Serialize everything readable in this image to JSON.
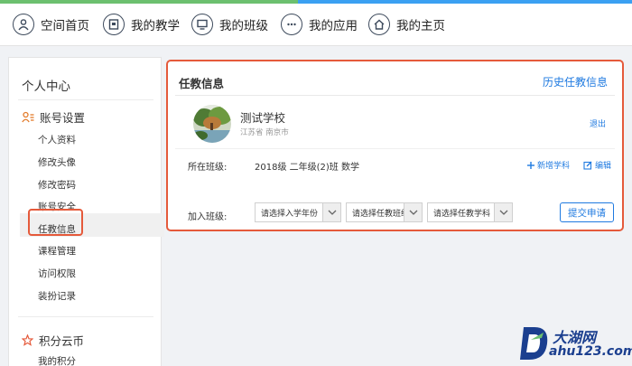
{
  "nav": {
    "items": [
      {
        "label": "空间首页",
        "icon": "user-icon"
      },
      {
        "label": "我的教学",
        "icon": "lesson-icon"
      },
      {
        "label": "我的班级",
        "icon": "monitor-icon"
      },
      {
        "label": "我的应用",
        "icon": "more-icon"
      },
      {
        "label": "我的主页",
        "icon": "home-icon"
      }
    ]
  },
  "sidebar": {
    "title": "个人中心",
    "account_section": "账号设置",
    "items": [
      "个人资料",
      "修改头像",
      "修改密码",
      "账号安全",
      "任教信息",
      "课程管理",
      "访问权限",
      "装扮记录"
    ],
    "active_item": "任教信息",
    "points_section": "积分云币",
    "points_items": [
      "我的积分"
    ]
  },
  "main": {
    "title": "任教信息",
    "history_link": "历史任教信息",
    "school": {
      "name": "测试学校",
      "location": "江苏省  南京市"
    },
    "logout": "退出",
    "class_label": "所在班级:",
    "class_value": "2018级 二年级(2)班",
    "subject_value": "数学",
    "add_subject": "新增学科",
    "edit": "编辑",
    "join_label": "加入班级:",
    "selects": [
      {
        "placeholder": "请选择入学年份"
      },
      {
        "placeholder": "请选择任教班级"
      },
      {
        "placeholder": "请选择任教学科"
      }
    ],
    "submit": "提交申请"
  },
  "watermark": {
    "cn": "大湖网",
    "url": "ahu123.com",
    "letter": "D"
  },
  "colors": {
    "accent": "#1f7ae0",
    "highlight": "#e55a3b",
    "stripe_blue": "#3aa0f2",
    "stripe_green": "#6cc06f",
    "watermark": "#1b3f8f"
  }
}
